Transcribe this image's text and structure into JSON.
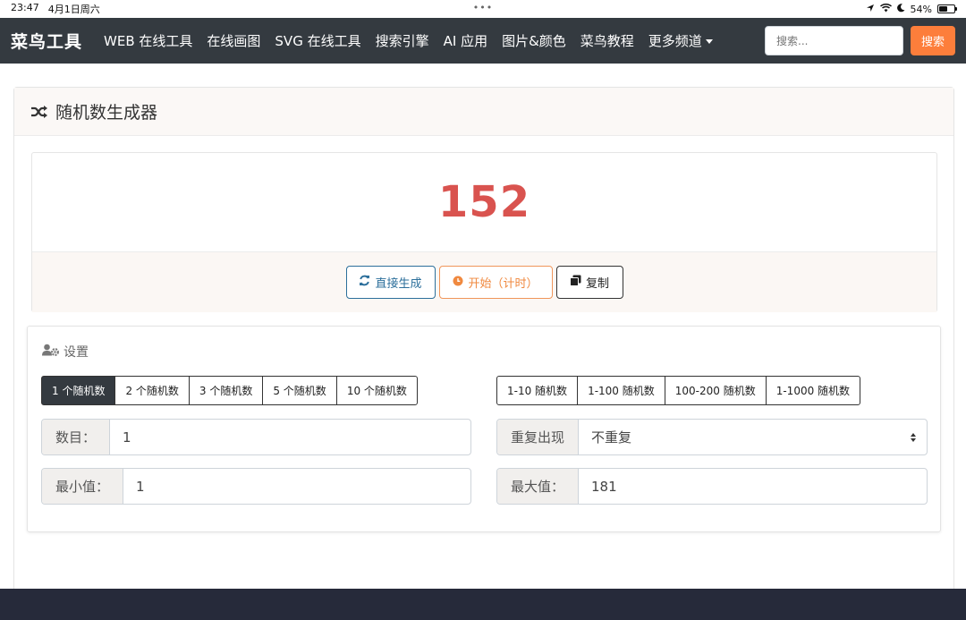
{
  "status_bar": {
    "time": "23:47",
    "date": "4月1日周六",
    "dots": "•••",
    "battery": "54%",
    "battery_level": 0.54
  },
  "navbar": {
    "brand": "菜鸟工具",
    "links": [
      "WEB 在线工具",
      "在线画图",
      "SVG 在线工具",
      "搜索引擎",
      "AI 应用",
      "图片&颜色",
      "菜鸟教程",
      "更多频道"
    ],
    "search_placeholder": "搜索...",
    "search_button": "搜索"
  },
  "card": {
    "title": "随机数生成器"
  },
  "result": {
    "number": "152",
    "color": "#d9534f"
  },
  "actions": {
    "generate": "直接生成",
    "start": "开始（计时）",
    "copy": "复制"
  },
  "settings": {
    "title": "设置",
    "count_presets": [
      {
        "label": "1 个随机数",
        "active": true
      },
      {
        "label": "2 个随机数",
        "active": false
      },
      {
        "label": "3 个随机数",
        "active": false
      },
      {
        "label": "5 个随机数",
        "active": false
      },
      {
        "label": "10 个随机数",
        "active": false
      }
    ],
    "range_presets": [
      "1-10 随机数",
      "1-100 随机数",
      "100-200 随机数",
      "1-1000 随机数"
    ],
    "count": {
      "label": "数目：",
      "value": "1"
    },
    "repeat": {
      "label": "重复出现",
      "value": "不重复"
    },
    "min": {
      "label": "最小值：",
      "value": "1"
    },
    "max": {
      "label": "最大值：",
      "value": "181"
    }
  },
  "colors": {
    "navbar": "#343a40",
    "accent": "#fd7e3b",
    "primary": "#2c6f9b",
    "footer": "#262a3a"
  }
}
